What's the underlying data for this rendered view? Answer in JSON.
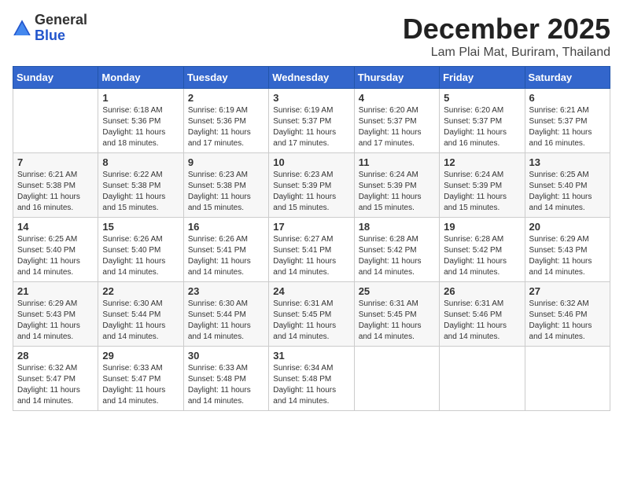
{
  "header": {
    "logo_general": "General",
    "logo_blue": "Blue",
    "month": "December 2025",
    "location": "Lam Plai Mat, Buriram, Thailand"
  },
  "weekdays": [
    "Sunday",
    "Monday",
    "Tuesday",
    "Wednesday",
    "Thursday",
    "Friday",
    "Saturday"
  ],
  "weeks": [
    [
      {
        "day": "",
        "info": ""
      },
      {
        "day": "1",
        "info": "Sunrise: 6:18 AM\nSunset: 5:36 PM\nDaylight: 11 hours\nand 18 minutes."
      },
      {
        "day": "2",
        "info": "Sunrise: 6:19 AM\nSunset: 5:36 PM\nDaylight: 11 hours\nand 17 minutes."
      },
      {
        "day": "3",
        "info": "Sunrise: 6:19 AM\nSunset: 5:37 PM\nDaylight: 11 hours\nand 17 minutes."
      },
      {
        "day": "4",
        "info": "Sunrise: 6:20 AM\nSunset: 5:37 PM\nDaylight: 11 hours\nand 17 minutes."
      },
      {
        "day": "5",
        "info": "Sunrise: 6:20 AM\nSunset: 5:37 PM\nDaylight: 11 hours\nand 16 minutes."
      },
      {
        "day": "6",
        "info": "Sunrise: 6:21 AM\nSunset: 5:37 PM\nDaylight: 11 hours\nand 16 minutes."
      }
    ],
    [
      {
        "day": "7",
        "info": "Sunrise: 6:21 AM\nSunset: 5:38 PM\nDaylight: 11 hours\nand 16 minutes."
      },
      {
        "day": "8",
        "info": "Sunrise: 6:22 AM\nSunset: 5:38 PM\nDaylight: 11 hours\nand 15 minutes."
      },
      {
        "day": "9",
        "info": "Sunrise: 6:23 AM\nSunset: 5:38 PM\nDaylight: 11 hours\nand 15 minutes."
      },
      {
        "day": "10",
        "info": "Sunrise: 6:23 AM\nSunset: 5:39 PM\nDaylight: 11 hours\nand 15 minutes."
      },
      {
        "day": "11",
        "info": "Sunrise: 6:24 AM\nSunset: 5:39 PM\nDaylight: 11 hours\nand 15 minutes."
      },
      {
        "day": "12",
        "info": "Sunrise: 6:24 AM\nSunset: 5:39 PM\nDaylight: 11 hours\nand 15 minutes."
      },
      {
        "day": "13",
        "info": "Sunrise: 6:25 AM\nSunset: 5:40 PM\nDaylight: 11 hours\nand 14 minutes."
      }
    ],
    [
      {
        "day": "14",
        "info": "Sunrise: 6:25 AM\nSunset: 5:40 PM\nDaylight: 11 hours\nand 14 minutes."
      },
      {
        "day": "15",
        "info": "Sunrise: 6:26 AM\nSunset: 5:40 PM\nDaylight: 11 hours\nand 14 minutes."
      },
      {
        "day": "16",
        "info": "Sunrise: 6:26 AM\nSunset: 5:41 PM\nDaylight: 11 hours\nand 14 minutes."
      },
      {
        "day": "17",
        "info": "Sunrise: 6:27 AM\nSunset: 5:41 PM\nDaylight: 11 hours\nand 14 minutes."
      },
      {
        "day": "18",
        "info": "Sunrise: 6:28 AM\nSunset: 5:42 PM\nDaylight: 11 hours\nand 14 minutes."
      },
      {
        "day": "19",
        "info": "Sunrise: 6:28 AM\nSunset: 5:42 PM\nDaylight: 11 hours\nand 14 minutes."
      },
      {
        "day": "20",
        "info": "Sunrise: 6:29 AM\nSunset: 5:43 PM\nDaylight: 11 hours\nand 14 minutes."
      }
    ],
    [
      {
        "day": "21",
        "info": "Sunrise: 6:29 AM\nSunset: 5:43 PM\nDaylight: 11 hours\nand 14 minutes."
      },
      {
        "day": "22",
        "info": "Sunrise: 6:30 AM\nSunset: 5:44 PM\nDaylight: 11 hours\nand 14 minutes."
      },
      {
        "day": "23",
        "info": "Sunrise: 6:30 AM\nSunset: 5:44 PM\nDaylight: 11 hours\nand 14 minutes."
      },
      {
        "day": "24",
        "info": "Sunrise: 6:31 AM\nSunset: 5:45 PM\nDaylight: 11 hours\nand 14 minutes."
      },
      {
        "day": "25",
        "info": "Sunrise: 6:31 AM\nSunset: 5:45 PM\nDaylight: 11 hours\nand 14 minutes."
      },
      {
        "day": "26",
        "info": "Sunrise: 6:31 AM\nSunset: 5:46 PM\nDaylight: 11 hours\nand 14 minutes."
      },
      {
        "day": "27",
        "info": "Sunrise: 6:32 AM\nSunset: 5:46 PM\nDaylight: 11 hours\nand 14 minutes."
      }
    ],
    [
      {
        "day": "28",
        "info": "Sunrise: 6:32 AM\nSunset: 5:47 PM\nDaylight: 11 hours\nand 14 minutes."
      },
      {
        "day": "29",
        "info": "Sunrise: 6:33 AM\nSunset: 5:47 PM\nDaylight: 11 hours\nand 14 minutes."
      },
      {
        "day": "30",
        "info": "Sunrise: 6:33 AM\nSunset: 5:48 PM\nDaylight: 11 hours\nand 14 minutes."
      },
      {
        "day": "31",
        "info": "Sunrise: 6:34 AM\nSunset: 5:48 PM\nDaylight: 11 hours\nand 14 minutes."
      },
      {
        "day": "",
        "info": ""
      },
      {
        "day": "",
        "info": ""
      },
      {
        "day": "",
        "info": ""
      }
    ]
  ]
}
